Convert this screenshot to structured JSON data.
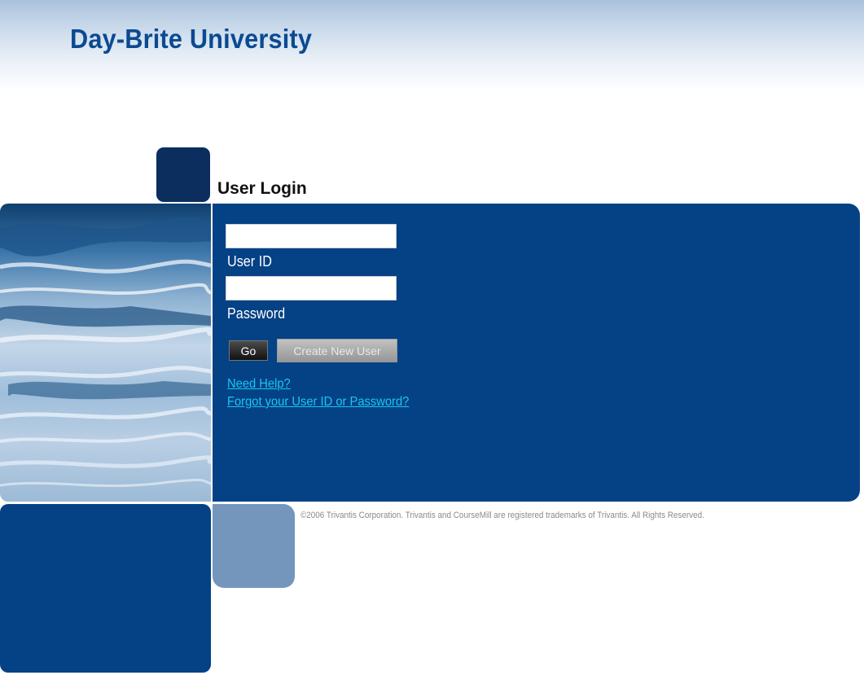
{
  "header": {
    "site_title": "Day-Brite University"
  },
  "login": {
    "heading": "User Login",
    "user_id_label": "User ID",
    "user_id_value": "",
    "password_label": "Password",
    "password_value": "",
    "go_label": "Go",
    "create_user_label": "Create New User",
    "need_help_link": "Need Help?",
    "forgot_link": "Forgot your User ID or Password?"
  },
  "footer": {
    "copyright": "©2006 Trivantis Corporation. Trivantis and CourseMill are registered trademarks of Trivantis. All Rights Reserved."
  },
  "colors": {
    "brand_blue": "#044185",
    "dark_navy": "#0b2e5e",
    "title_blue": "#0b4a92",
    "link_cyan": "#19c8f2",
    "muted_blue": "#7496bc"
  }
}
